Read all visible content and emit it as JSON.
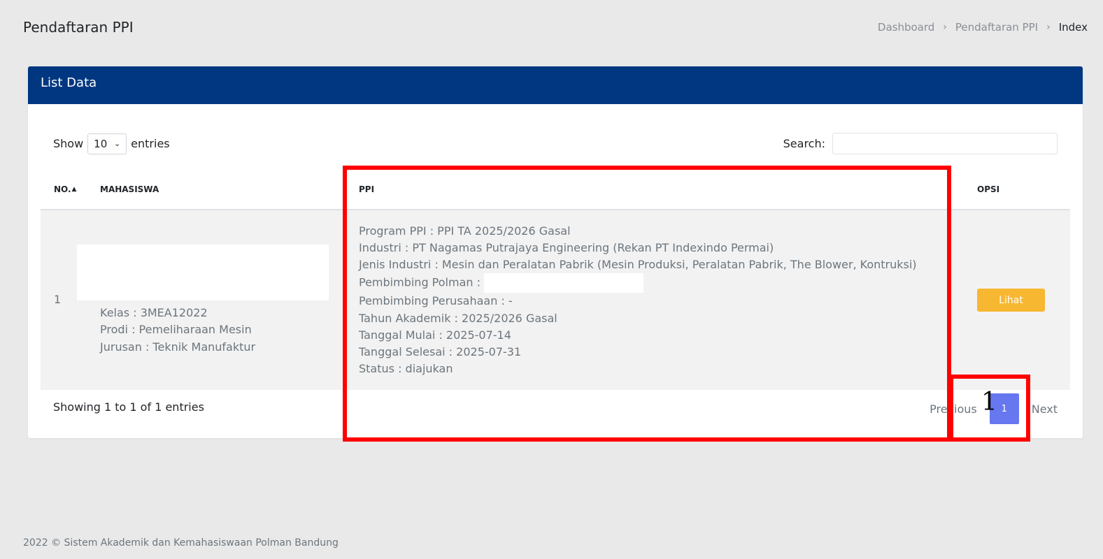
{
  "header": {
    "title": "Pendaftaran PPI",
    "breadcrumb": [
      "Dashboard",
      "Pendaftaran PPI",
      "Index"
    ],
    "separator": "›"
  },
  "card": {
    "title": "List Data",
    "length": {
      "show_label": "Show",
      "value": "10",
      "entries_label": "entries"
    },
    "search": {
      "label": "Search:",
      "value": ""
    },
    "columns": {
      "no": "NO.",
      "mahasiswa": "MAHASISWA",
      "ppi": "PPI",
      "opsi": "OPSI"
    },
    "rows": [
      {
        "no": "1",
        "mahasiswa": {
          "kelas": "Kelas : 3MEA12022",
          "prodi": "Prodi : Pemeliharaan Mesin",
          "jurusan": "Jurusan : Teknik Manufaktur"
        },
        "ppi": {
          "program": "Program PPI : PPI TA 2025/2026 Gasal",
          "industri": "Industri : PT Nagamas Putrajaya Engineering (Rekan PT Indexindo Permai)",
          "jenis_industri": "Jenis Industri : Mesin dan Peralatan Pabrik (Mesin Produksi, Peralatan Pabrik, The Blower, Kontruksi)",
          "pembimbing_polman_label": "Pembimbing Polman :",
          "pembimbing_perusahaan": "Pembimbing Perusahaan : -",
          "tahun_akademik": "Tahun Akademik : 2025/2026 Gasal",
          "tanggal_mulai": "Tanggal Mulai : 2025-07-14",
          "tanggal_selesai": "Tanggal Selesai : 2025-07-31",
          "status": "Status : diajukan"
        },
        "action": "Lihat"
      }
    ],
    "info": "Showing 1 to 1 of 1 entries",
    "pagination": {
      "previous": "Previous",
      "current": "1",
      "next": "Next"
    }
  },
  "annotation": {
    "label": "1"
  },
  "footer": {
    "copyright": "2022 © Sistem Akademik dan Kemahasiswaan Polman Bandung"
  },
  "colors": {
    "header_bg": "#003780",
    "button": "#f7b731",
    "page_active": "#6777ef",
    "highlight": "#ff0000"
  }
}
